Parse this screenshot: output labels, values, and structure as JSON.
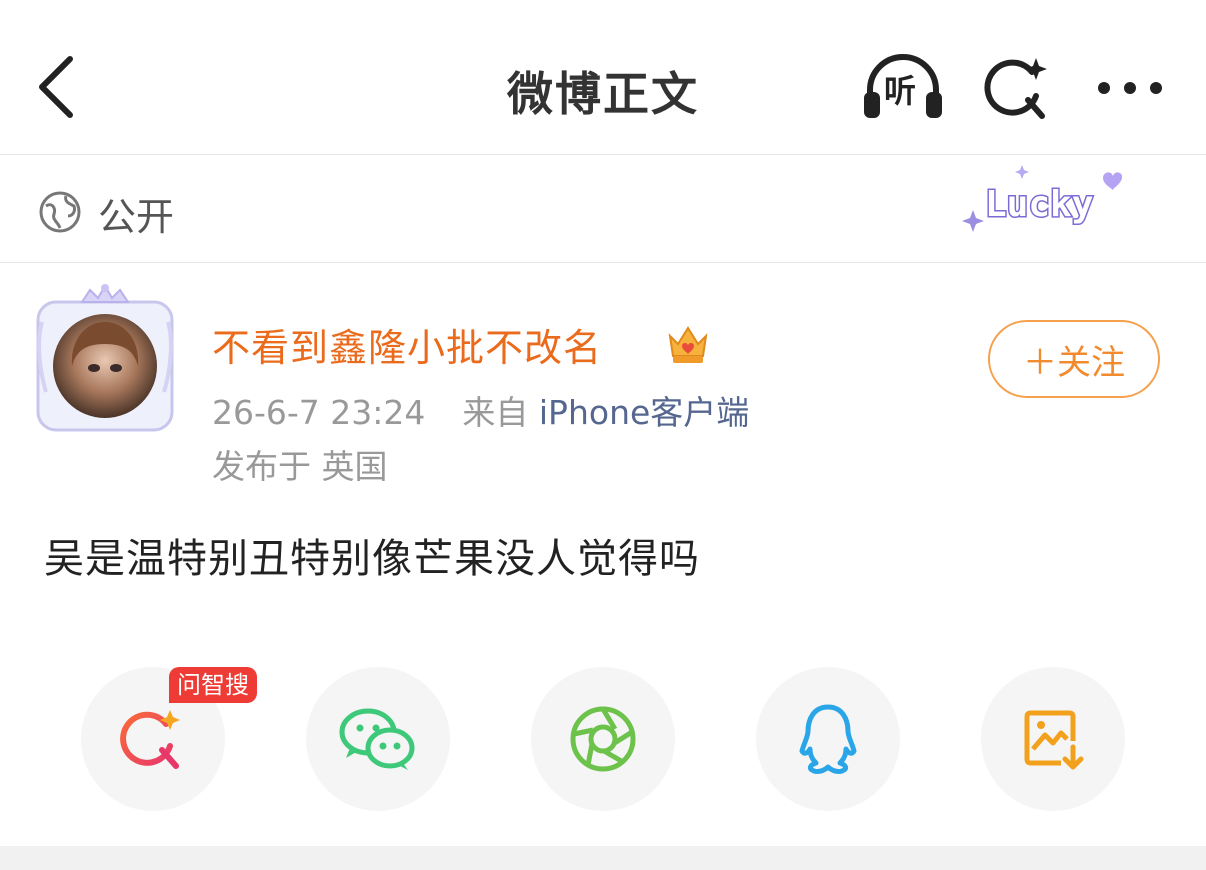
{
  "header": {
    "title": "微博正文",
    "back_icon": "back-chevron-icon",
    "listen_icon_label": "听",
    "search_icon": "ai-search-icon",
    "more_icon": "more-dots-icon"
  },
  "visibility": {
    "icon": "globe-icon",
    "label": "公开",
    "sticker_icon": "lucky-sticker-icon"
  },
  "author": {
    "name": "不看到鑫隆小批不改名",
    "badge_icon": "crown-icon",
    "timestamp": "26-6-7 23:24",
    "from_prefix": "来自",
    "source": "iPhone客户端",
    "location": "发布于 英国",
    "follow_label": "＋关注"
  },
  "post": {
    "text": "吴是温特别丑特别像芒果没人觉得吗"
  },
  "share": {
    "badge": "问智搜",
    "items": [
      {
        "icon": "zhisou-search-icon"
      },
      {
        "icon": "wechat-icon"
      },
      {
        "icon": "moments-icon"
      },
      {
        "icon": "qq-icon"
      },
      {
        "icon": "save-image-icon"
      }
    ]
  },
  "colors": {
    "username": "#ea6b1c",
    "follow": "#f28b2f",
    "source_link": "#55678f",
    "badge": "#ee3b35",
    "wechat": "#3ec97a",
    "moments": "#6cc24a",
    "qq": "#2aa6e8",
    "save_image": "#f2a11c"
  }
}
